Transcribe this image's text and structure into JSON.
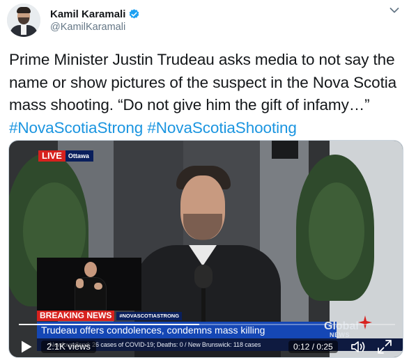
{
  "author": {
    "display_name": "Kamil Karamali",
    "handle": "@KamilKaramali",
    "verified": true,
    "verified_color": "#1da1f2"
  },
  "tweet": {
    "text_plain": "Prime Minister Justin Trudeau asks media to not say the name or show pictures of the suspect in the Nova Scotia mass shooting. “Do not give him the gift of infamy…” ",
    "hashtags": [
      "#NovaScotiaStrong",
      "#NovaScotiaShooting"
    ],
    "hashtag_color": "#1b95e0"
  },
  "video": {
    "live_label": "LIVE",
    "live_location": "Ottawa",
    "breaking_label": "BREAKING NEWS",
    "breaking_tag": "#NOVASCOTIASTRONG",
    "headline": "Trudeau offers condolences, condemns mass killing",
    "ticker": "Newfoundland: 26 cases of COVID-19; Deaths: 0  /  New Brunswick: 118 cases",
    "network_name": "Global",
    "network_sub": "NEWS",
    "views": "2.1K views",
    "time": "0:12 / 0:25",
    "progress": 0.48
  },
  "icons": {
    "menu": "chevron-down-icon",
    "verified": "verified-icon",
    "play": "play-icon",
    "volume": "volume-icon",
    "fullscreen": "fullscreen-icon"
  }
}
